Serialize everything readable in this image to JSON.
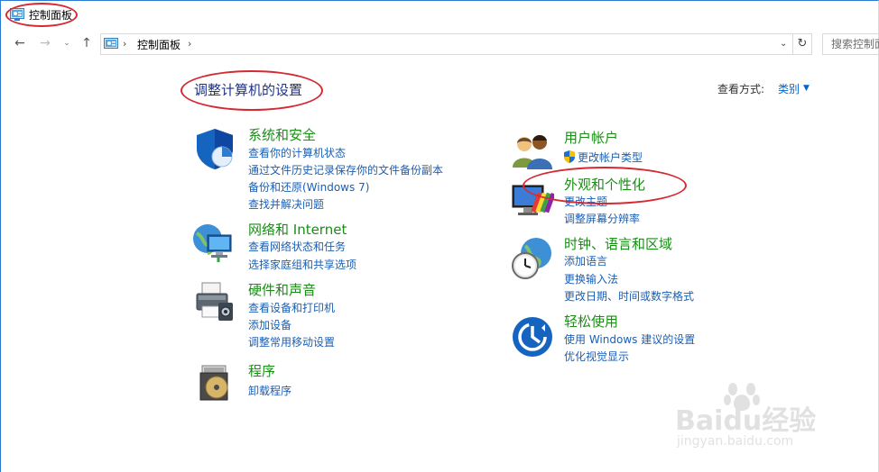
{
  "window": {
    "title": "控制面板"
  },
  "address_bar": {
    "crumb": "控制面板",
    "separator": "›"
  },
  "search": {
    "placeholder": "搜索控制面板"
  },
  "header": {
    "title": "调整计算机的设置",
    "view_by_label": "查看方式:",
    "view_by_value": "类别"
  },
  "categories": {
    "system": {
      "title": "系统和安全",
      "links": [
        "查看你的计算机状态",
        "通过文件历史记录保存你的文件备份副本",
        "备份和还原(Windows 7)",
        "查找并解决问题"
      ]
    },
    "network": {
      "title": "网络和 Internet",
      "links": [
        "查看网络状态和任务",
        "选择家庭组和共享选项"
      ]
    },
    "hardware": {
      "title": "硬件和声音",
      "links": [
        "查看设备和打印机",
        "添加设备",
        "调整常用移动设置"
      ]
    },
    "programs": {
      "title": "程序",
      "links": [
        "卸载程序"
      ]
    },
    "users": {
      "title": "用户帐户",
      "links": [
        "更改帐户类型"
      ]
    },
    "appearance": {
      "title": "外观和个性化",
      "links": [
        "更改主题",
        "调整屏幕分辨率"
      ]
    },
    "clock": {
      "title": "时钟、语言和区域",
      "links": [
        "添加语言",
        "更换输入法",
        "更改日期、时间或数字格式"
      ]
    },
    "ease": {
      "title": "轻松使用",
      "links": [
        "使用 Windows 建议的设置",
        "优化视觉显示"
      ]
    }
  },
  "watermark": {
    "brand": "Baidu经验",
    "url": "jingyan.baidu.com"
  },
  "colors": {
    "link": "#1a5fb4",
    "category_title": "#188f14",
    "page_title": "#1e3287",
    "annotation": "#d42a33"
  }
}
